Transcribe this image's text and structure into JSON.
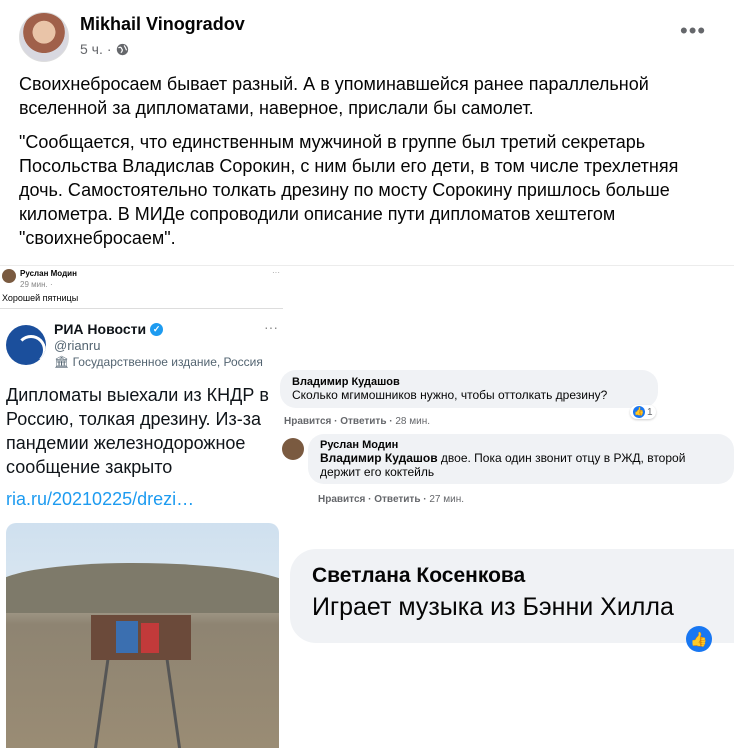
{
  "post": {
    "author": "Mikhail Vinogradov",
    "time": "5 ч.",
    "separator": "·",
    "privacy_icon": "globe-icon",
    "more_label": "•••",
    "paragraph1": "Своихнебросаем бывает разный. А в упоминавшейся ранее параллельной вселенной за дипломатами, наверное, прислали бы самолет.",
    "paragraph2": "\"Сообщается, что единственным мужчиной в группе был третий секретарь Посольства Владислав Сорокин, с ним были его дети, в том числе трехлетняя дочь. Самостоятельно толкать дрезину по мосту Сорокину пришлось больше километра. В МИДе сопроводили описание пути дипломатов хештегом \"своихнебросаем\"."
  },
  "embedded": {
    "small_comment": {
      "name": "Руслан Модин",
      "time": "29 мин. ·",
      "text": "Хорошей пятницы",
      "dots": "···"
    },
    "tweet": {
      "account": "РИА Новости",
      "verified": "✓",
      "handle": "@rianru",
      "label": "Государственное издание, Россия",
      "text": "Дипломаты выехали из КНДР в Россию, толкая дрезину. Из-за пандемии железнодорожное сообщение закрыто",
      "link": "ria.ru/20210225/drezi…",
      "dots": "···"
    },
    "comment1": {
      "name": "Владимир Кудашов",
      "text": "Сколько мгимошников нужно, чтобы оттолкать дрезину?",
      "like": "Нравится",
      "reply": "Ответить",
      "time": "28 мин.",
      "reaction_count": "1"
    },
    "comment2": {
      "name": "Руслан Модин",
      "mention": "Владимир Кудашов",
      "text": " двое. Пока один звонит отцу в РЖД, второй держит его коктейль",
      "like": "Нравится",
      "reply": "Ответить",
      "time": "27 мин."
    },
    "comment3": {
      "name": "Светлана Косенкова",
      "text": "Играет музыка из Бэнни Хилла"
    }
  },
  "colors": {
    "link": "#1d9bf0",
    "fb_blue": "#1877f2",
    "bubble_bg": "#f0f2f5"
  }
}
